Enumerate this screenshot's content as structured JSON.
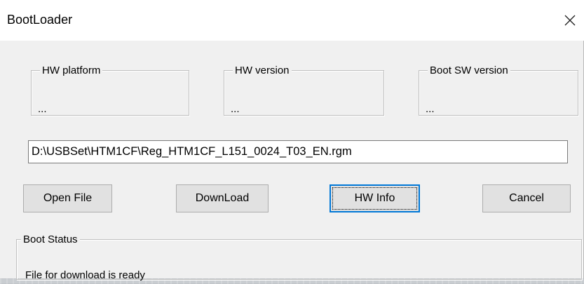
{
  "window": {
    "title": "BootLoader"
  },
  "groups": {
    "hw_platform": {
      "label": "HW platform",
      "value": "..."
    },
    "hw_version": {
      "label": "HW version",
      "value": "..."
    },
    "boot_sw_version": {
      "label": "Boot SW version",
      "value": "..."
    }
  },
  "file_path": {
    "value": "D:\\USBSet\\HTM1CF\\Reg_HTM1CF_L151_0024_T03_EN.rgm"
  },
  "buttons": {
    "open_file": "Open File",
    "download": "DownLoad",
    "hw_info": "HW Info",
    "cancel": "Cancel"
  },
  "boot_status": {
    "label": "Boot Status",
    "message": "File for download is ready"
  },
  "icons": {
    "close": "close-icon"
  }
}
